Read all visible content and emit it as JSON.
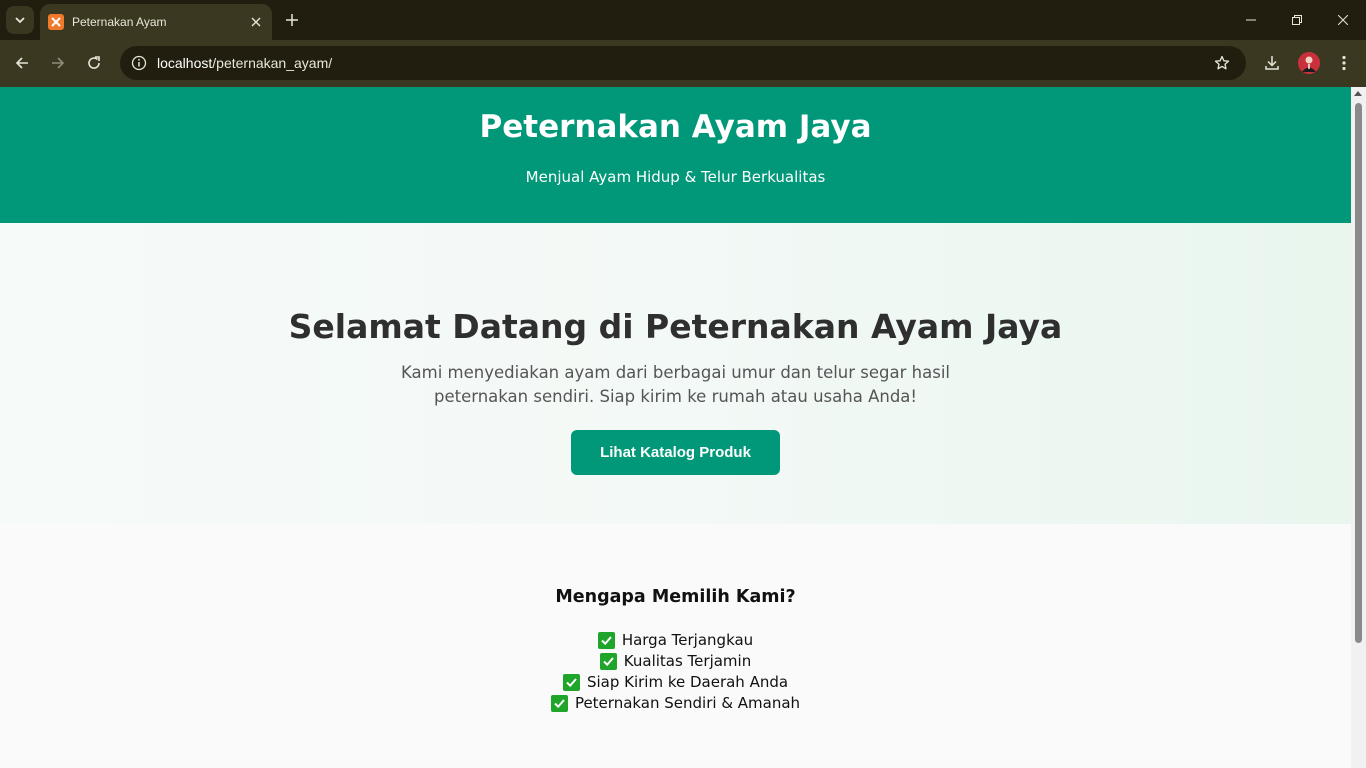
{
  "browser": {
    "tab_title": "Peternakan Ayam",
    "url_host": "localhost",
    "url_path": "/peternakan_ayam/"
  },
  "header": {
    "title": "Peternakan Ayam Jaya",
    "tagline": "Menjual Ayam Hidup & Telur Berkualitas"
  },
  "hero": {
    "heading": "Selamat Datang di Peternakan Ayam Jaya",
    "description": "Kami menyediakan ayam dari berbagai umur dan telur segar hasil peternakan sendiri. Siap kirim ke rumah atau usaha Anda!",
    "cta_label": "Lihat Katalog Produk"
  },
  "why": {
    "heading": "Mengapa Memilih Kami?",
    "items": [
      "Harga Terjangkau",
      "Kualitas Terjamin",
      "Siap Kirim ke Daerah Anda",
      "Peternakan Sendiri & Amanah"
    ]
  },
  "colors": {
    "brand": "#009879",
    "check": "#1fa52a",
    "chrome": "#3a3820"
  },
  "icons": [
    "tab-list-icon",
    "xampp-favicon-icon",
    "close-icon",
    "plus-icon",
    "minimize-icon",
    "restore-icon",
    "window-close-icon",
    "back-icon",
    "forward-icon",
    "reload-icon",
    "site-info-icon",
    "star-icon",
    "download-icon",
    "menu-icon",
    "check-icon"
  ]
}
